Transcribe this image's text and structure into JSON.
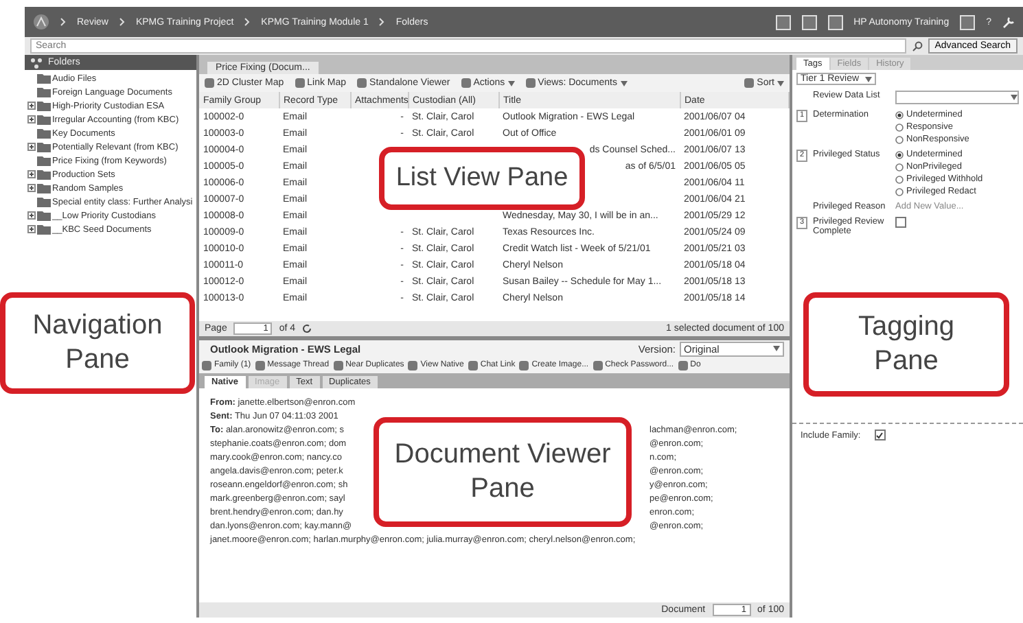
{
  "breadcrumb": [
    "Review",
    "KPMG Training Project",
    "KPMG Training Module 1",
    "Folders"
  ],
  "user": "HP Autonomy Training",
  "help": "?",
  "search": {
    "placeholder": "Search"
  },
  "advanced_search": "Advanced Search",
  "navigation": {
    "title": "Folders",
    "folders": [
      {
        "label": "Audio Files",
        "expandable": false
      },
      {
        "label": "Foreign Language Documents",
        "expandable": false
      },
      {
        "label": "High-Priority Custodian ESA",
        "expandable": true
      },
      {
        "label": "Irregular Accounting (from KBC)",
        "expandable": true
      },
      {
        "label": "Key Documents",
        "expandable": false
      },
      {
        "label": "Potentially Relevant (from KBC)",
        "expandable": true
      },
      {
        "label": "Price Fixing (from Keywords)",
        "expandable": false
      },
      {
        "label": "Production Sets",
        "expandable": true
      },
      {
        "label": "Random Samples",
        "expandable": true
      },
      {
        "label": "Special entity class: Further Analysi",
        "expandable": false
      },
      {
        "label": "__Low Priority Custodians",
        "expandable": true
      },
      {
        "label": "__KBC Seed Documents",
        "expandable": true
      }
    ]
  },
  "list_view": {
    "tab": "Price Fixing (Docum...",
    "toolbar": [
      {
        "label": "2D Cluster Map",
        "dropdown": false
      },
      {
        "label": "Link Map",
        "dropdown": false
      },
      {
        "label": "Standalone Viewer",
        "dropdown": false
      },
      {
        "label": "Actions",
        "dropdown": true
      },
      {
        "label": "Views: Documents",
        "dropdown": true
      }
    ],
    "sort": "Sort",
    "columns": [
      "Family Group",
      "Record Type",
      "Attachments",
      "Custodian (All)",
      "Title",
      "Date"
    ],
    "rows": [
      {
        "family": "100002-0",
        "record_type": "Email",
        "attachments": "-",
        "custodian": "St. Clair, Carol",
        "title": "Outlook Migration - EWS Legal",
        "date": "2001/06/07 04"
      },
      {
        "family": "100003-0",
        "record_type": "Email",
        "attachments": "-",
        "custodian": "St. Clair, Carol",
        "title": "Out of Office",
        "date": "2001/06/01 09"
      },
      {
        "family": "100004-0",
        "record_type": "Email",
        "title_fragment": "ds Counsel Sched...",
        "date": "2001/06/07 13"
      },
      {
        "family": "100005-0",
        "record_type": "Email",
        "title_fragment": "as of 6/5/01",
        "date": "2001/06/05 05"
      },
      {
        "family": "100006-0",
        "record_type": "Email",
        "date": "2001/06/04 11"
      },
      {
        "family": "100007-0",
        "record_type": "Email",
        "date": "2001/06/04 21"
      },
      {
        "family": "100008-0",
        "record_type": "Email",
        "title": "Wednesday, May 30, I will be in an...",
        "date": "2001/05/29 12"
      },
      {
        "family": "100009-0",
        "record_type": "Email",
        "attachments": "-",
        "custodian": "St. Clair, Carol",
        "title": "Texas Resources Inc.",
        "date": "2001/05/24 09"
      },
      {
        "family": "100010-0",
        "record_type": "Email",
        "attachments": "-",
        "custodian": "St. Clair, Carol",
        "title": "Credit Watch list - Week of 5/21/01",
        "date": "2001/05/21 03"
      },
      {
        "family": "100011-0",
        "record_type": "Email",
        "attachments": "-",
        "custodian": "St. Clair, Carol",
        "title": "Cheryl Nelson",
        "date": "2001/05/18 04"
      },
      {
        "family": "100012-0",
        "record_type": "Email",
        "attachments": "-",
        "custodian": "St. Clair, Carol",
        "title": "Susan Bailey -- Schedule for May 1...",
        "date": "2001/05/18 13"
      },
      {
        "family": "100013-0",
        "record_type": "Email",
        "attachments": "-",
        "custodian": "St. Clair, Carol",
        "title": "Cheryl Nelson",
        "date": "2001/05/18 14"
      }
    ],
    "pager": {
      "label": "Page",
      "value": "1",
      "total": "of 4"
    },
    "selection_info": "1 selected document of 100"
  },
  "document_viewer": {
    "title": "Outlook Migration - EWS Legal",
    "version_label": "Version:",
    "version": "Original",
    "toolbar": [
      "Family (1)",
      "Message Thread",
      "Near Duplicates",
      "View Native",
      "Chat Link",
      "Create Image...",
      "Check Password...",
      "Do"
    ],
    "tabs": [
      {
        "label": "Native",
        "selected": true,
        "disabled": false
      },
      {
        "label": "Image",
        "selected": false,
        "disabled": true
      },
      {
        "label": "Text",
        "selected": false,
        "disabled": false
      },
      {
        "label": "Duplicates",
        "selected": false,
        "disabled": false
      }
    ],
    "from_label": "From:",
    "from": "janette.elbertson@enron.com",
    "sent_label": "Sent:",
    "sent": "Thu Jun 07 04:11:03 2001",
    "to_label": "To:",
    "to_lines": [
      {
        "left": "alan.aronowitz@enron.com; s",
        "right": "lachman@enron.com;"
      },
      {
        "left": "stephanie.coats@enron.com; dom",
        "right": "@enron.com;"
      },
      {
        "left": "mary.cook@enron.com; nancy.co",
        "right": "n.com;"
      },
      {
        "left": "angela.davis@enron.com; peter.k",
        "right": "@enron.com;"
      },
      {
        "left": "roseann.engeldorf@enron.com; sh",
        "right": "y@enron.com;"
      },
      {
        "left": "mark.greenberg@enron.com; sayl",
        "right": "pe@enron.com;"
      },
      {
        "left": "brent.hendry@enron.com; dan.hy",
        "right": "enron.com;"
      },
      {
        "left": "dan.lyons@enron.com; kay.mann@",
        "right": "@enron.com;"
      },
      {
        "left": "janet.moore@enron.com; harlan.murphy@enron.com; julia.murray@enron.com; cheryl.nelson@enron.com;"
      }
    ],
    "pager": {
      "label": "Document",
      "value": "1",
      "total": "of 100"
    }
  },
  "tagging": {
    "tabs": [
      {
        "label": "Tags",
        "selected": true
      },
      {
        "label": "Fields",
        "selected": false
      },
      {
        "label": "History",
        "selected": false
      }
    ],
    "review_set": "Tier 1 Review",
    "fields": [
      {
        "kind": "dropdown",
        "label": "Review Data List"
      },
      {
        "kind": "radio",
        "number": "1",
        "label": "Determination",
        "options": [
          {
            "label": "Undetermined",
            "selected": true
          },
          {
            "label": "Responsive",
            "selected": false
          },
          {
            "label": "NonResponsive",
            "selected": false
          }
        ]
      },
      {
        "kind": "radio",
        "number": "2",
        "label": "Privileged Status",
        "options": [
          {
            "label": "Undetermined",
            "selected": true
          },
          {
            "label": "NonPrivileged",
            "selected": false
          },
          {
            "label": "Privileged Withhold",
            "selected": false
          },
          {
            "label": "Privileged Redact",
            "selected": false
          }
        ]
      },
      {
        "kind": "value",
        "label": "Privileged Reason",
        "placeholder": "Add New Value..."
      },
      {
        "kind": "checkbox",
        "number": "3",
        "label": "Privileged Review Complete",
        "checked": false
      }
    ],
    "include_family": {
      "label": "Include Family:",
      "checked": true
    }
  },
  "callouts": [
    {
      "text": "List View Pane"
    },
    {
      "text": "Navigation Pane"
    },
    {
      "text": "Tagging Pane"
    },
    {
      "text": "Document Viewer Pane"
    }
  ]
}
